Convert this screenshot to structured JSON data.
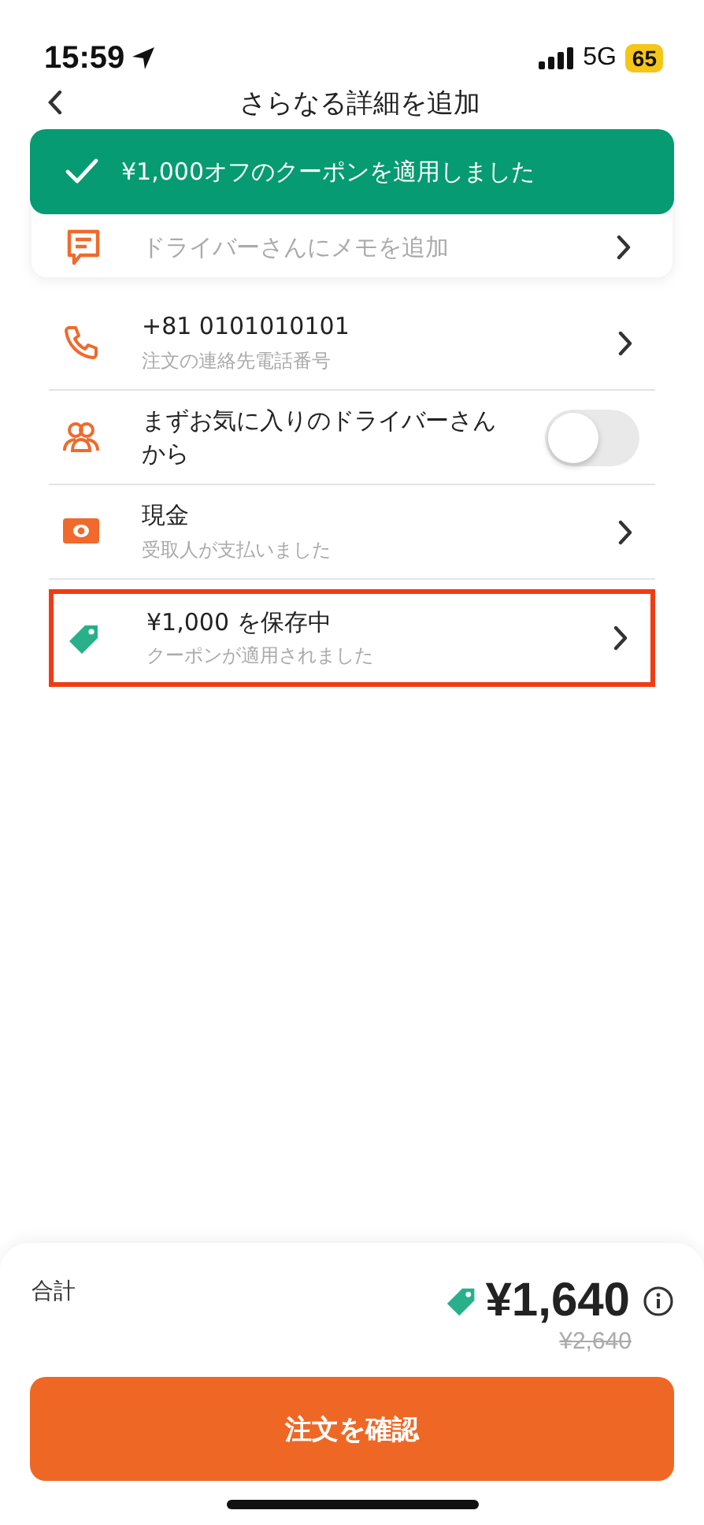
{
  "status_bar": {
    "time": "15:59",
    "network": "5G",
    "battery": "65"
  },
  "header": {
    "title": "さらなる詳細を追加"
  },
  "toast": {
    "message": "¥1,000オフのクーポンを適用しました"
  },
  "memo": {
    "placeholder": "ドライバーさんにメモを追加"
  },
  "items": [
    {
      "kind": "link",
      "title": "+81 0101010101",
      "subtitle": "注文の連絡先電話番号",
      "highlighted": false
    },
    {
      "kind": "toggle",
      "title": "まずお気に入りのドライバーさんから",
      "on": false,
      "highlighted": false
    },
    {
      "kind": "link",
      "title": "現金",
      "subtitle": "受取人が支払いました",
      "highlighted": false
    },
    {
      "kind": "link",
      "title": "¥1,000 を保存中",
      "subtitle": "クーポンが適用されました",
      "highlighted": true
    }
  ],
  "total": {
    "label": "合計",
    "price": "¥1,640",
    "original_price": "¥2,640"
  },
  "confirm_button": "注文を確認"
}
